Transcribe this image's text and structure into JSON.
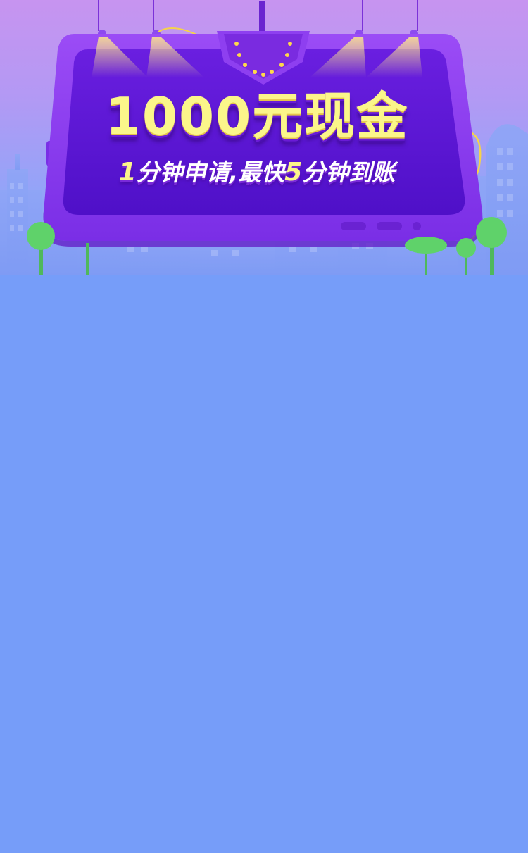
{
  "banner": {
    "headline": "1000元现金",
    "subline": {
      "num1": "1",
      "part1": "分钟申请,最快",
      "num2": "5",
      "part2": "分钟到账"
    }
  },
  "colors": {
    "background": "#769df9",
    "screen_purple": "#5a16d6",
    "frame_purple": "#8a3cf3",
    "headline_yellow": "#fbf68a",
    "tree_green": "#5fd26a"
  }
}
